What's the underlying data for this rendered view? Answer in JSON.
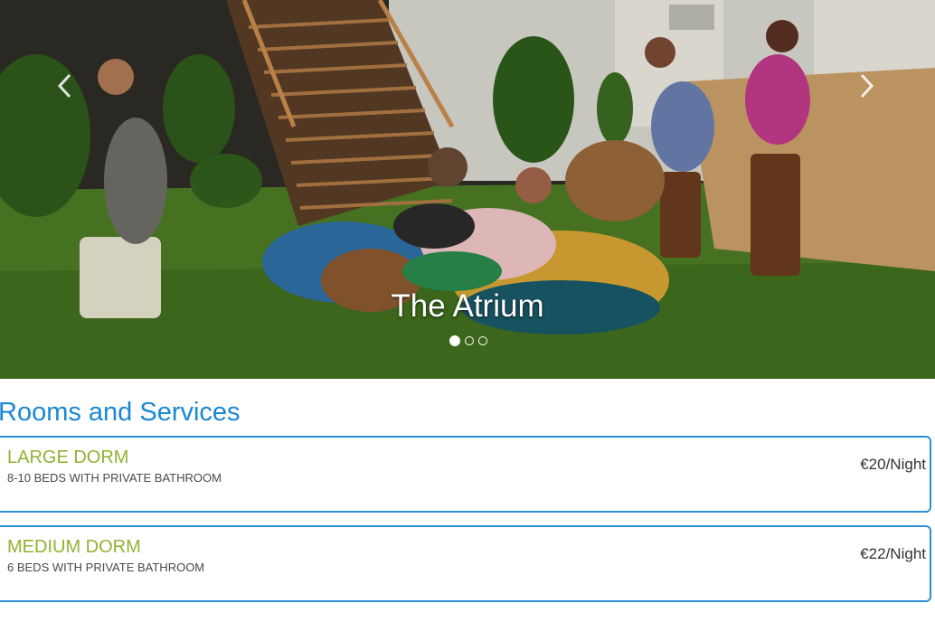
{
  "carousel": {
    "caption": "The Atrium",
    "slide_count": 3,
    "active_slide": 1
  },
  "rooms_section": {
    "title": "Rooms and Services",
    "rooms": [
      {
        "name": "LARGE DORM",
        "description": "8-10 BEDS WITH PRIVATE BATHROOM",
        "price": "€20/Night"
      },
      {
        "name": "MEDIUM DORM",
        "description": "6 BEDS WITH PRIVATE BATHROOM",
        "price": "€22/Night"
      }
    ]
  },
  "colors": {
    "section_title": "#1a87d4",
    "room_name": "#93b131",
    "card_border": "#2d8fd5"
  }
}
